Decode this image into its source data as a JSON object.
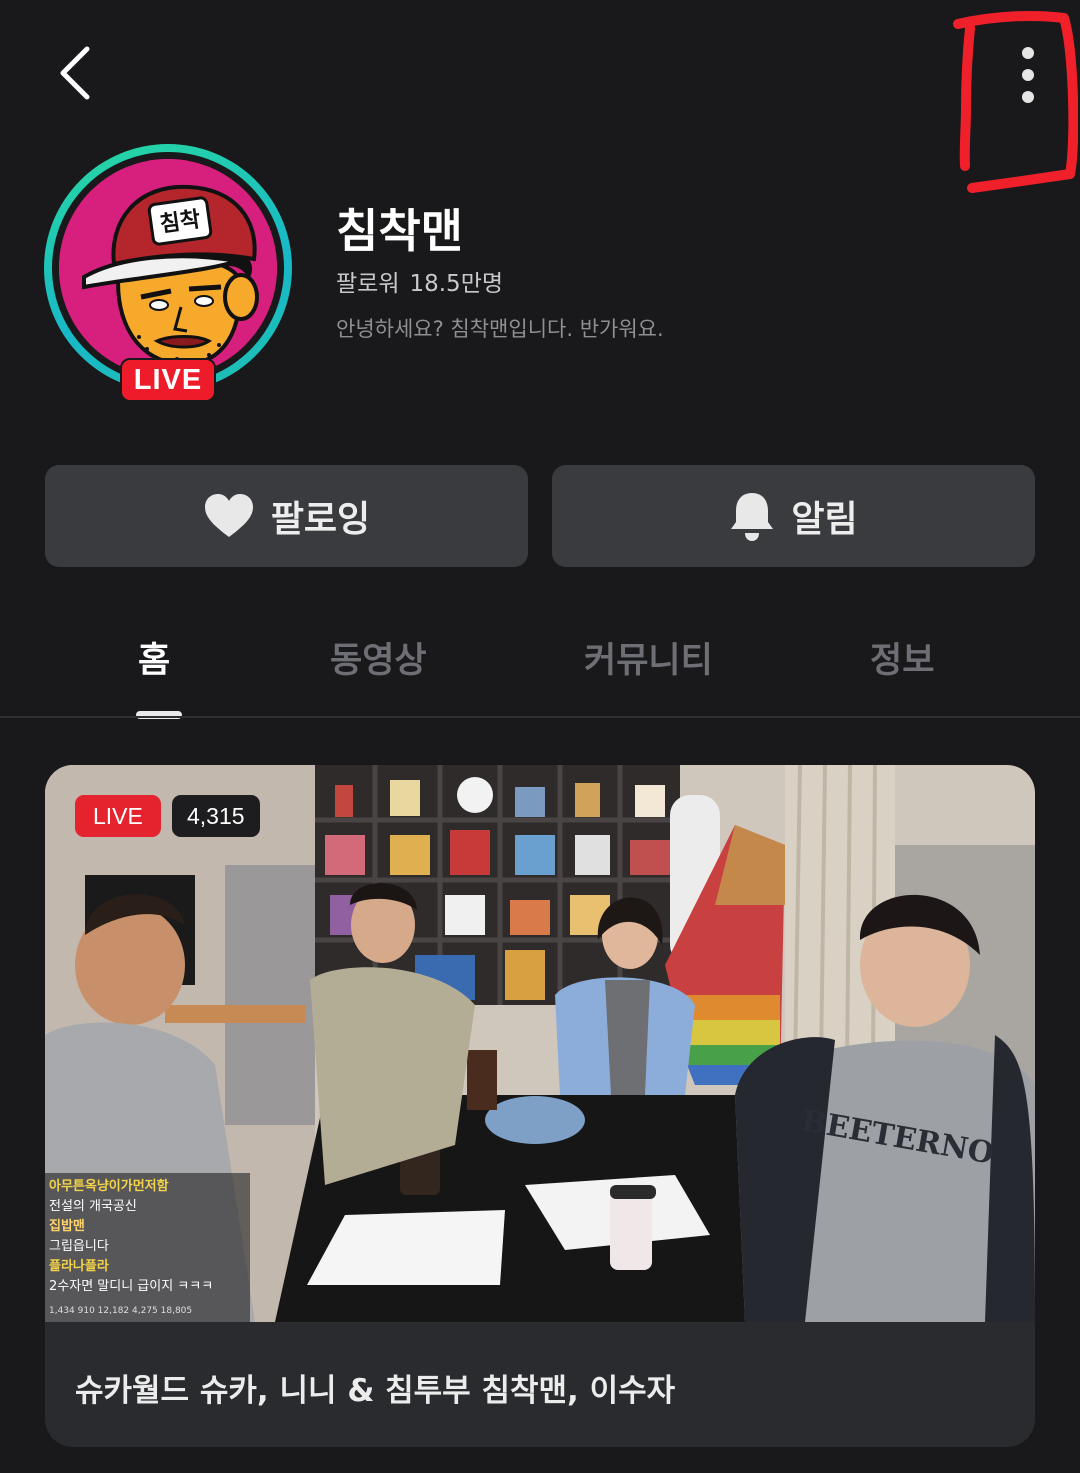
{
  "header": {
    "back_icon": "chevron-left-icon",
    "more_icon": "more-vertical-icon"
  },
  "profile": {
    "live_badge": "LIVE",
    "avatar_text": "침착",
    "name": "침착맨",
    "followers_label": "팔로워",
    "followers_count": "18.5만명",
    "intro": "안녕하세요? 침착맨입니다. 반가워요."
  },
  "actions": {
    "follow_label": "팔로잉",
    "follow_icon": "heart-icon",
    "alarm_label": "알림",
    "alarm_icon": "bell-icon"
  },
  "tabs": [
    {
      "label": "홈",
      "active": true
    },
    {
      "label": "동영상",
      "active": false
    },
    {
      "label": "커뮤니티",
      "active": false
    },
    {
      "label": "정보",
      "active": false
    }
  ],
  "live_card": {
    "live_label": "LIVE",
    "viewers": "4,315",
    "title": "슈카월드 슈카, 니니 & 침투부 침착맨, 이수자",
    "chat": [
      {
        "nick": "아무튼옥냥이가먼저함",
        "msg": "전설의 개국공신"
      },
      {
        "nick": "집밥맨",
        "msg": "그립읍니다"
      },
      {
        "nick": "플라나플라",
        "msg": "2수자면 말디니 급이지 ㅋㅋㅋ"
      }
    ],
    "stats": "1,434  910  12,182  4,275  18,805"
  },
  "colors": {
    "background": "#19191b",
    "button": "#3a3b3f",
    "live_red": "#e5232f",
    "ring_teal": "#20c8a8",
    "avatar_bg": "#d7207e"
  }
}
